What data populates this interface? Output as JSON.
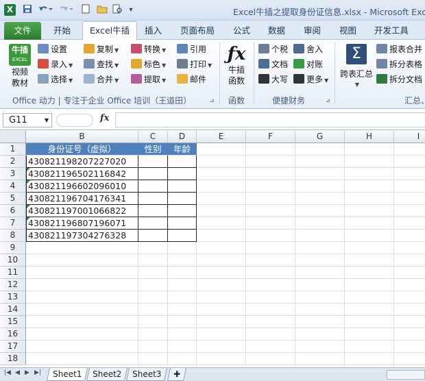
{
  "window": {
    "title": "Excel牛插之提取身份证信息.xlsx - Microsoft Excel",
    "app_logo": "X"
  },
  "quick_access": [
    "save-icon",
    "undo-icon",
    "redo-icon",
    "new-icon",
    "open-icon",
    "print-preview-icon",
    "customize-icon"
  ],
  "menu": {
    "items": [
      "文件",
      "开始",
      "Excel牛插",
      "插入",
      "页面布局",
      "公式",
      "数据",
      "审阅",
      "视图",
      "开发工具"
    ],
    "active": "Excel牛插"
  },
  "ribbon": {
    "logo_top": "牛插",
    "logo_sub": "EXCEL",
    "logo_label1": "视频",
    "logo_label2": "教材",
    "col1": [
      "设置",
      "录入",
      "选择"
    ],
    "col2": [
      "复制",
      "查找",
      "合并"
    ],
    "col3": [
      "转换",
      "标色",
      "提取"
    ],
    "col4": [
      "引用",
      "打印",
      "邮件"
    ],
    "fx_label1": "牛插",
    "fx_label2": "函数",
    "fin1": [
      "个税",
      "文档",
      "大写"
    ],
    "fin2": [
      "舍入",
      "对账",
      "更多"
    ],
    "sum_label": "跨表汇总",
    "right": [
      "报表合并",
      "拆分表格",
      "拆分文档"
    ],
    "group1_label": "Office 动力 | 专注于企业 Office 培训（王道田）",
    "group2_label": "函数",
    "group3_label": "便捷财务",
    "group4_label": "汇总、"
  },
  "formula_bar": {
    "name_box": "G11",
    "fx": "fx",
    "formula": ""
  },
  "grid": {
    "columns": [
      "B",
      "C",
      "D",
      "E",
      "F",
      "G",
      "H",
      "I"
    ],
    "rows": [
      "1",
      "2",
      "3",
      "4",
      "5",
      "6",
      "7",
      "8",
      "9",
      "10",
      "11",
      "12",
      "13",
      "14",
      "15",
      "16",
      "17",
      "18"
    ],
    "header_row": [
      "身份证号（虚拟）",
      "性别",
      "年龄"
    ],
    "ids": [
      "430821198207227020",
      "430821196502116842",
      "430821196602096010",
      "430821196704176341",
      "430821197001066822",
      "430821196807196071",
      "430821197304276328"
    ]
  },
  "sheets": {
    "tabs": [
      "Sheet1",
      "Sheet2",
      "Sheet3"
    ],
    "active": "Sheet1"
  },
  "colors": {
    "header_fill": "#4f81bd",
    "file_tab": "#2c7d2e"
  }
}
